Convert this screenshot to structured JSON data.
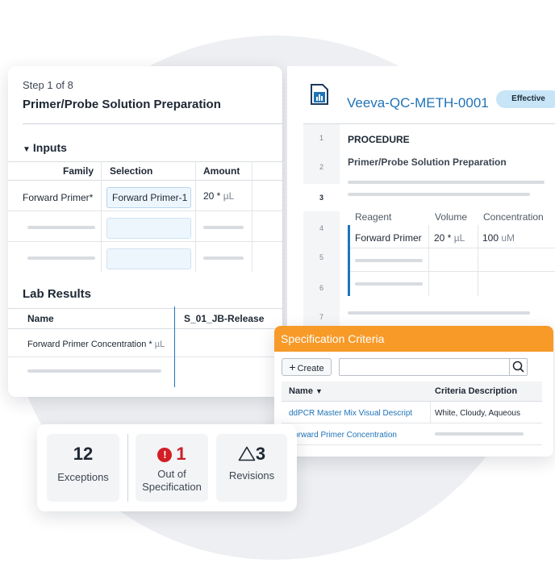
{
  "step": {
    "label": "Step 1 of 8",
    "title": "Primer/Probe Solution Preparation",
    "inputs_heading": "Inputs",
    "inputs_columns": [
      "Family",
      "Selection",
      "Amount"
    ],
    "input_row": {
      "family": "Forward Primer*",
      "selection": "Forward Primer-1",
      "amount_value": "20 *",
      "amount_unit": "µL"
    },
    "lab_results_heading": "Lab Results",
    "lab_columns": [
      "Name",
      "S_01_JB-Release"
    ],
    "lab_row": {
      "name": "Forward Primer Concentration *",
      "unit": "µL"
    }
  },
  "document": {
    "title": "Veeva-QC-METH-0001",
    "status_badge": "Effective",
    "line_numbers": [
      "1",
      "2",
      "3",
      "4",
      "5",
      "6",
      "7"
    ],
    "procedure_heading": "PROCEDURE",
    "procedure_subheading": "Primer/Probe Solution Preparation",
    "reagent_columns": [
      "Reagent",
      "Volume",
      "Concentration"
    ],
    "reagent_row": {
      "reagent": "Forward Primer",
      "volume_value": "20 *",
      "volume_unit": "µL",
      "conc_value": "100",
      "conc_unit": "uM"
    }
  },
  "spec": {
    "title": "Specification Criteria",
    "create_label": "Create",
    "search_value": "",
    "columns": [
      "Name",
      "Criteria Description"
    ],
    "rows": [
      {
        "name": "ddPCR Master Mix Visual Descript",
        "description": "White, Cloudy, Aqueous"
      },
      {
        "name": "Forward Primer Concentration",
        "description": ""
      }
    ]
  },
  "stats": {
    "exceptions": {
      "value": "12",
      "label": "Exceptions"
    },
    "oos": {
      "value": "1",
      "label_line1": "Out of",
      "label_line2": "Specification"
    },
    "revisions": {
      "value": "3",
      "label": "Revisions"
    }
  },
  "colors": {
    "accent_blue": "#1f73b7",
    "orange": "#f79a28",
    "alert_red": "#d31e25",
    "badge_bg": "#c7e5f7"
  },
  "icons": [
    "chevron-down-icon",
    "document-icon",
    "plus-icon",
    "search-icon",
    "sort-down-icon",
    "alert-circle-icon",
    "warning-triangle-icon"
  ]
}
